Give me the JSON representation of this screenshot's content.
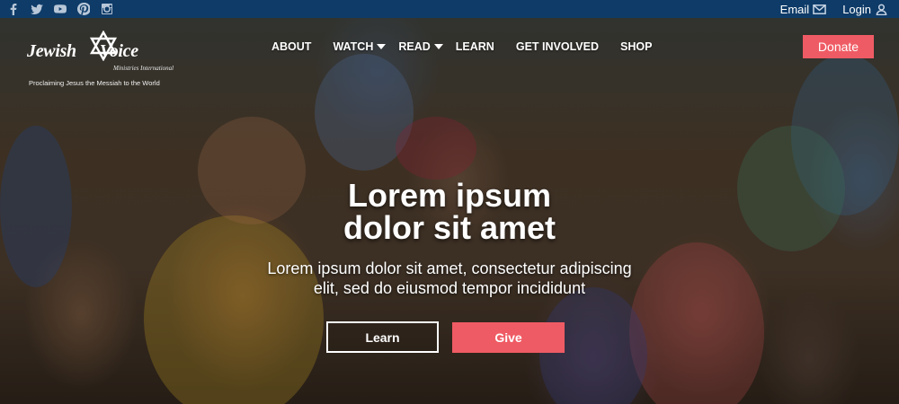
{
  "topbar": {
    "socials": [
      "facebook-icon",
      "twitter-icon",
      "youtube-icon",
      "pinterest-icon",
      "instagram-icon"
    ],
    "email_label": "Email",
    "login_label": "Login"
  },
  "logo": {
    "title_left": "Jewish",
    "title_right": "Voice",
    "subtitle": "Ministries International",
    "tagline": "Proclaiming Jesus the Messiah to the World"
  },
  "nav": {
    "items": [
      {
        "label": "ABOUT",
        "dropdown": false
      },
      {
        "label": "WATCH",
        "dropdown": true
      },
      {
        "label": "READ",
        "dropdown": true
      },
      {
        "label": "LEARN",
        "dropdown": false
      },
      {
        "label": "GET INVOLVED",
        "dropdown": false
      },
      {
        "label": "SHOP",
        "dropdown": false
      }
    ],
    "donate_label": "Donate"
  },
  "hero": {
    "title_line1": "Lorem ipsum",
    "title_line2": "dolor sit amet",
    "subtitle_line1": "Lorem ipsum dolor sit amet, consectetur adipiscing",
    "subtitle_line2": "elit, sed do eiusmod tempor incididunt",
    "learn_label": "Learn",
    "give_label": "Give"
  },
  "colors": {
    "topbar": "#0e3b68",
    "accent": "#ef5b64"
  }
}
